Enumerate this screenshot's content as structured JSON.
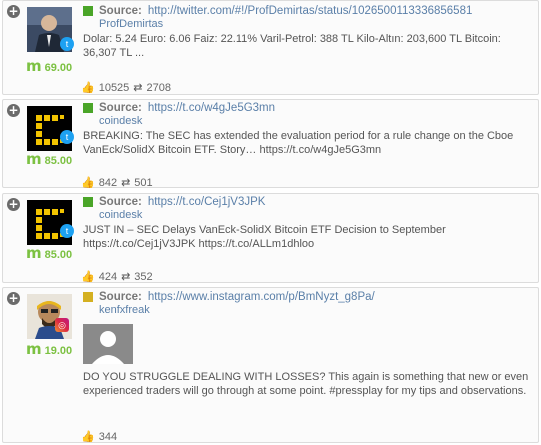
{
  "posts": [
    {
      "source_label": "Source:",
      "url": "http://twitter.com/#!/ProfDemirtas/status/1026500113336856581",
      "handle": "ProfDemirtas",
      "text": "Dolar: 5.24 Euro: 6.06 Faiz: 22.11% Varil-Petrol: 388 TL Kilo-Altın: 203,600 TL Bitcoin: 36,307 TL ...",
      "score": "69.00",
      "likes": "10525",
      "retweets": "2708",
      "platform": "twitter",
      "color": "#4aa528"
    },
    {
      "source_label": "Source:",
      "url": "https://t.co/w4gJe5G3mn",
      "handle": "coindesk",
      "text": "BREAKING: The SEC has extended the evaluation period for a rule change on the Cboe VanEck/SolidX Bitcoin ETF. Story… https://t.co/w4gJe5G3mn",
      "score": "85.00",
      "likes": "842",
      "retweets": "501",
      "platform": "twitter",
      "color": "#4aa528"
    },
    {
      "source_label": "Source:",
      "url": "https://t.co/Cej1jV3JPK",
      "handle": "coindesk",
      "text": "JUST IN – SEC Delays VanEck-SolidX Bitcoin ETF Decision to September https://t.co/Cej1jV3JPK https://t.co/ALLm1dhloo",
      "score": "85.00",
      "likes": "424",
      "retweets": "352",
      "platform": "twitter",
      "color": "#4aa528"
    },
    {
      "source_label": "Source:",
      "url": "https://www.instagram.com/p/BmNyzt_g8Pa/",
      "handle": "kenfxfreak",
      "text": "DO YOU STRUGGLE DEALING WITH LOSSES? This again is something that new or even experienced traders will go through at some point. #pressplay for my tips and observations.",
      "score": "19.00",
      "likes": "344",
      "platform": "instagram",
      "color": "#d4b021"
    }
  ],
  "icons": {
    "expand": "plus-circle-icon",
    "like": "thumbs-up-icon",
    "retweet": "retweet-icon",
    "score": "m-score-icon"
  },
  "glyphs": {
    "expand": "+",
    "like": "👍",
    "retweet": "⇄",
    "m": "m"
  }
}
